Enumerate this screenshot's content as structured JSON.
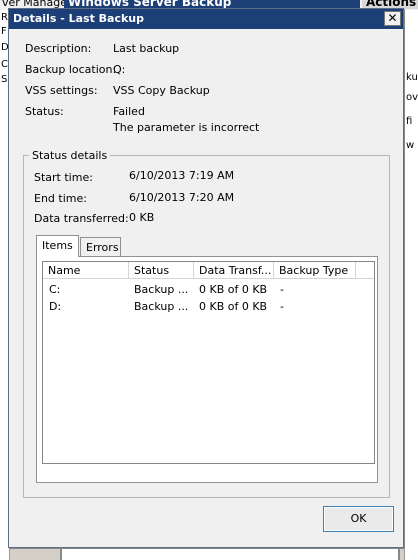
{
  "background": {
    "top_left_text": "ver Manage",
    "top_center_text": "Windows Server Backup",
    "top_right_text": "Actions",
    "left_letters": [
      "R",
      "F",
      "D",
      "C",
      "S"
    ],
    "right_fragments": [
      "",
      "ku",
      "ov",
      "fi",
      "w"
    ]
  },
  "dialog": {
    "title": "Details - Last Backup",
    "close_glyph": "✕"
  },
  "summary": {
    "description_label": "Description:",
    "description_value": "Last backup",
    "location_label": "Backup location:",
    "location_value": "Q:",
    "vss_label": "VSS settings:",
    "vss_value": "VSS Copy Backup",
    "status_label": "Status:",
    "status_value": "Failed",
    "status_message": "The parameter is incorrect"
  },
  "status_details": {
    "group_title": "Status details",
    "start_label": "Start time:",
    "start_value": "6/10/2013 7:19 AM",
    "end_label": "End time:",
    "end_value": "6/10/2013 7:20 AM",
    "data_label": "Data transferred:",
    "data_value": "0 KB"
  },
  "tabs": [
    {
      "label": "Items",
      "active": true
    },
    {
      "label": "Errors",
      "active": false
    }
  ],
  "items_table": {
    "columns": [
      "Name",
      "Status",
      "Data Transf...",
      "Backup Type"
    ],
    "rows": [
      {
        "name": "C:",
        "status": "Backup ...",
        "data": "0 KB of 0 KB",
        "type": "-"
      },
      {
        "name": "D:",
        "status": "Backup ...",
        "data": "0 KB of 0 KB",
        "type": "-"
      }
    ]
  },
  "buttons": {
    "ok_label": "OK"
  },
  "colors": {
    "titlebar": "#1c3f78",
    "dialog_bg": "#f0f0f0",
    "ok_border": "#3c7fb1"
  }
}
